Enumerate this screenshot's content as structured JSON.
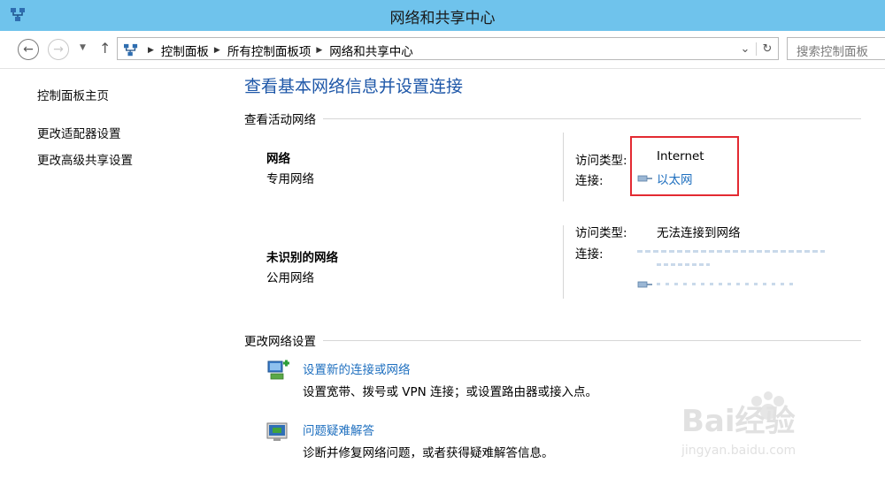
{
  "window": {
    "title": "网络和共享中心"
  },
  "navigation": {
    "breadcrumbs": [
      "控制面板",
      "所有控制面板项",
      "网络和共享中心"
    ],
    "search_placeholder": "搜索控制面板"
  },
  "sidebar": {
    "items": [
      {
        "label": "控制面板主页"
      },
      {
        "label": "更改适配器设置"
      },
      {
        "label": "更改高级共享设置"
      }
    ]
  },
  "main": {
    "heading": "查看基本网络信息并设置连接",
    "active_networks_title": "查看活动网络",
    "networks": [
      {
        "name": "网络",
        "type": "专用网络",
        "access_label": "访问类型:",
        "access_value": "Internet",
        "conn_label": "连接:",
        "conn_value": "以太网"
      },
      {
        "name": "未识别的网络",
        "type": "公用网络",
        "access_label": "访问类型:",
        "access_value": "无法连接到网络",
        "conn_label": "连接:"
      }
    ],
    "change_settings_title": "更改网络设置",
    "tasks": [
      {
        "link": "设置新的连接或网络",
        "desc": "设置宽带、拨号或 VPN 连接；或设置路由器或接入点。"
      },
      {
        "link": "问题疑难解答",
        "desc": "诊断并修复网络问题，或者获得疑难解答信息。"
      }
    ]
  },
  "watermark": {
    "brand": "Bai经验",
    "url": "jingyan.baidu.com"
  },
  "colors": {
    "titlebar": "#6fc3ec",
    "link": "#1e6fbf",
    "heading": "#1e57a8",
    "highlight": "#e32a32"
  }
}
